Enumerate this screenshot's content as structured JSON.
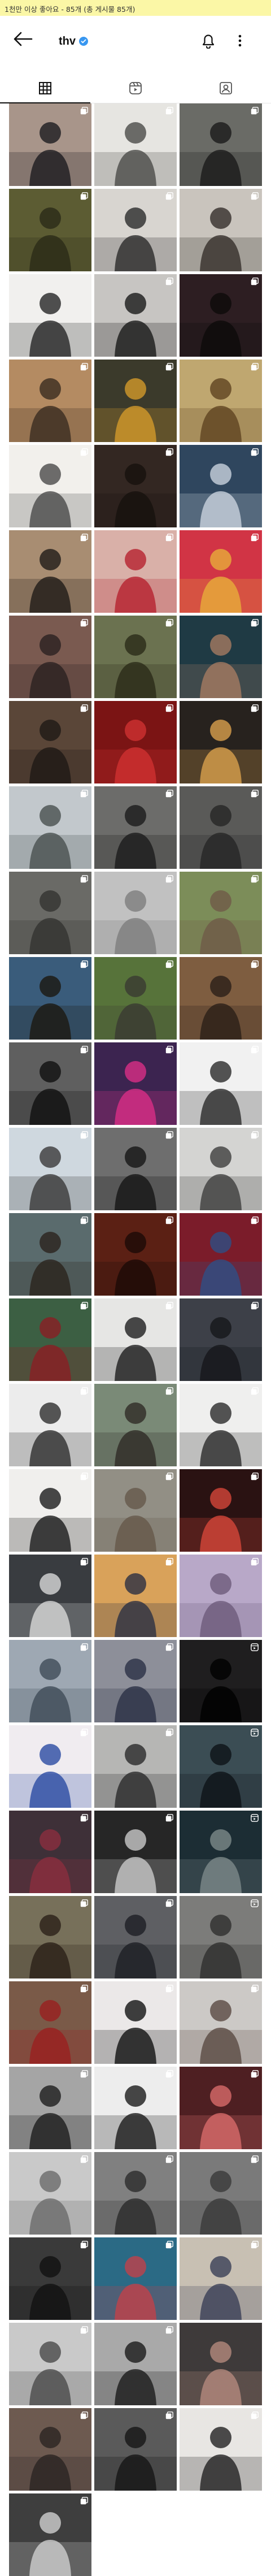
{
  "banner_text": "1천만 이상 좋아요 - 85개 (총 게시물 85개)",
  "profile": {
    "username": "thv",
    "verified": true
  },
  "tabs": [
    {
      "name": "grid",
      "icon": "grid-icon",
      "active": true
    },
    {
      "name": "reels",
      "icon": "reels-icon",
      "active": false
    },
    {
      "name": "tagged",
      "icon": "tagged-icon",
      "active": false
    }
  ],
  "posts": [
    {
      "bg": "#a8958a",
      "fg": "#1c1b1f",
      "badge": "multi"
    },
    {
      "bg": "#e6e5e1",
      "fg": "#4b4b49",
      "badge": "multi"
    },
    {
      "bg": "#6a6b66",
      "fg": "#1a1a1a",
      "badge": "multi"
    },
    {
      "bg": "#5c5c33",
      "fg": "#2a2a18",
      "badge": "multi"
    },
    {
      "bg": "#d8d5d0",
      "fg": "#2b2b2b",
      "badge": "multi"
    },
    {
      "bg": "#c9c4bd",
      "fg": "#352e2a",
      "badge": "multi"
    },
    {
      "bg": "#f1f0ee",
      "fg": "#262626",
      "badge": "none"
    },
    {
      "bg": "#c7c5c2",
      "fg": "#191919",
      "badge": "multi"
    },
    {
      "bg": "#2d1e22",
      "fg": "#0d0a0a",
      "badge": "multi"
    },
    {
      "bg": "#b48b62",
      "fg": "#3a2c20",
      "badge": "multi"
    },
    {
      "bg": "#3b3a2b",
      "fg": "#d39a2a",
      "badge": "multi"
    },
    {
      "bg": "#bfa770",
      "fg": "#5f4420",
      "badge": "multi"
    },
    {
      "bg": "#f2f0ec",
      "fg": "#4a4a4a",
      "badge": "multi"
    },
    {
      "bg": "#332722",
      "fg": "#17110e",
      "badge": "multi"
    },
    {
      "bg": "#2f465e",
      "fg": "#c9d2dd",
      "badge": "multi"
    },
    {
      "bg": "#a88d72",
      "fg": "#1f1b18",
      "badge": "multi"
    },
    {
      "bg": "#d9b0a8",
      "fg": "#b5222e",
      "badge": "multi"
    },
    {
      "bg": "#d13445",
      "fg": "#e7ad3a",
      "badge": "multi"
    },
    {
      "bg": "#7a5a50",
      "fg": "#2b2020",
      "badge": "multi"
    },
    {
      "bg": "#6b7250",
      "fg": "#2a2a18",
      "badge": "multi"
    },
    {
      "bg": "#1f3a44",
      "fg": "#a57b62",
      "badge": "multi"
    },
    {
      "bg": "#5a4638",
      "fg": "#1e1915",
      "badge": "multi"
    },
    {
      "bg": "#7b1414",
      "fg": "#d03131",
      "badge": "multi"
    },
    {
      "bg": "#27221e",
      "fg": "#d9a04c",
      "badge": "multi"
    },
    {
      "bg": "#c2c8cc",
      "fg": "#49504f",
      "badge": "multi"
    },
    {
      "bg": "#6c6c6a",
      "fg": "#1c1c1c",
      "badge": "multi"
    },
    {
      "bg": "#5a5a58",
      "fg": "#262626",
      "badge": "multi"
    },
    {
      "bg": "#6a6a66",
      "fg": "#333331",
      "badge": "multi"
    },
    {
      "bg": "#c1c1c1",
      "fg": "#7d7d7d",
      "badge": "multi"
    },
    {
      "bg": "#7c8d59",
      "fg": "#6f5a47",
      "badge": "multi"
    },
    {
      "bg": "#3a5c7b",
      "fg": "#1c1810",
      "badge": "multi"
    },
    {
      "bg": "#57733a",
      "fg": "#3a3a32",
      "badge": "multi"
    },
    {
      "bg": "#7e5d40",
      "fg": "#2a1f18",
      "badge": "multi"
    },
    {
      "bg": "#5f5f5f",
      "fg": "#0f0f0f",
      "badge": "multi"
    },
    {
      "bg": "#3c2450",
      "fg": "#d92e86",
      "badge": "multi"
    },
    {
      "bg": "#f1f1f1",
      "fg": "#2a2a2a",
      "badge": "multi"
    },
    {
      "bg": "#cfd8df",
      "fg": "#3a3a3a",
      "badge": "multi"
    },
    {
      "bg": "#6e6e6e",
      "fg": "#151515",
      "badge": "multi"
    },
    {
      "bg": "#d4d4d2",
      "fg": "#3d3d3d",
      "badge": "multi"
    },
    {
      "bg": "#5a6b6d",
      "fg": "#2a231d",
      "badge": "multi"
    },
    {
      "bg": "#5b2014",
      "fg": "#1c0a06",
      "badge": "multi"
    },
    {
      "bg": "#7b1c2a",
      "fg": "#2e4f84",
      "badge": "multi"
    },
    {
      "bg": "#3c5f43",
      "fg": "#8a1e24",
      "badge": "multi"
    },
    {
      "bg": "#e6e6e4",
      "fg": "#1e1e1e",
      "badge": "multi"
    },
    {
      "bg": "#3d4048",
      "fg": "#15161a",
      "badge": "multi"
    },
    {
      "bg": "#ececec",
      "fg": "#2e2e2e",
      "badge": "multi"
    },
    {
      "bg": "#7a8a77",
      "fg": "#2f2a26",
      "badge": "multi"
    },
    {
      "bg": "#efefee",
      "fg": "#2a2a2a",
      "badge": "multi"
    },
    {
      "bg": "#f0efed",
      "fg": "#1b1b1b",
      "badge": "multi"
    },
    {
      "bg": "#928f85",
      "fg": "#65584a",
      "badge": "multi"
    },
    {
      "bg": "#2a1212",
      "fg": "#d5463a",
      "badge": "multi"
    },
    {
      "bg": "#393c40",
      "fg": "#d8d8d8",
      "badge": "multi"
    },
    {
      "bg": "#d9a25a",
      "fg": "#2b3042",
      "badge": "multi"
    },
    {
      "bg": "#b8a8c8",
      "fg": "#6d5a7b",
      "badge": "multi"
    },
    {
      "bg": "#9ea8b3",
      "fg": "#3f4b57",
      "badge": "multi"
    },
    {
      "bg": "#8d8f99",
      "fg": "#2a3045",
      "badge": "multi"
    },
    {
      "bg": "#1f1e1f",
      "fg": "#000000",
      "badge": "reel"
    },
    {
      "bg": "#f0ecf0",
      "fg": "#2b4ba3",
      "badge": "multi"
    },
    {
      "bg": "#b6b6b4",
      "fg": "#2a2a2a",
      "badge": "multi"
    },
    {
      "bg": "#3b4d54",
      "fg": "#0e1316",
      "badge": "reel"
    },
    {
      "bg": "#3e3038",
      "fg": "#8b2e3e",
      "badge": "multi"
    },
    {
      "bg": "#262626",
      "fg": "#c9c9c9",
      "badge": "multi"
    },
    {
      "bg": "#1c2d34",
      "fg": "#7d8a8a",
      "badge": "reel"
    },
    {
      "bg": "#77705a",
      "fg": "#2a2118",
      "badge": "multi"
    },
    {
      "bg": "#5e5f63",
      "fg": "#1d1e24",
      "badge": "multi"
    },
    {
      "bg": "#7c7c7a",
      "fg": "#2e2e2e",
      "badge": "reel"
    },
    {
      "bg": "#7a5a48",
      "fg": "#9a1f1f",
      "badge": "multi"
    },
    {
      "bg": "#ebe8e8",
      "fg": "#111111",
      "badge": "multi"
    },
    {
      "bg": "#ccc9c6",
      "fg": "#5a4a42",
      "badge": "multi"
    },
    {
      "bg": "#a5a5a5",
      "fg": "#1d1d1d",
      "badge": "multi"
    },
    {
      "bg": "#ededed",
      "fg": "#1a1a1a",
      "badge": "multi"
    },
    {
      "bg": "#4e1f22",
      "fg": "#d86a6a",
      "badge": "multi"
    },
    {
      "bg": "#c9c9c9",
      "fg": "#6b6b6b",
      "badge": "multi"
    },
    {
      "bg": "#808080",
      "fg": "#2b2b2b",
      "badge": "multi"
    },
    {
      "bg": "#7a7a7a",
      "fg": "#3a3a3a",
      "badge": "multi"
    },
    {
      "bg": "#3a3a3a",
      "fg": "#111111",
      "badge": "multi"
    },
    {
      "bg": "#2b6a85",
      "fg": "#c1414a",
      "badge": "multi"
    },
    {
      "bg": "#c8c0b3",
      "fg": "#3a3f56",
      "badge": "multi"
    },
    {
      "bg": "#c9c9c9",
      "fg": "#4a4a4a",
      "badge": "multi"
    },
    {
      "bg": "#a9a9a9",
      "fg": "#1a1a1a",
      "badge": "multi"
    },
    {
      "bg": "#3e3a3a",
      "fg": "#b48a7d",
      "badge": "none"
    },
    {
      "bg": "#6d5a50",
      "fg": "#2a2422",
      "badge": "multi"
    },
    {
      "bg": "#5a5a5a",
      "fg": "#151515",
      "badge": "multi"
    },
    {
      "bg": "#e8e6e3",
      "fg": "#222222",
      "badge": "multi"
    },
    {
      "bg": "#3e3e3e",
      "fg": "#cfcfcf",
      "badge": "multi"
    }
  ]
}
